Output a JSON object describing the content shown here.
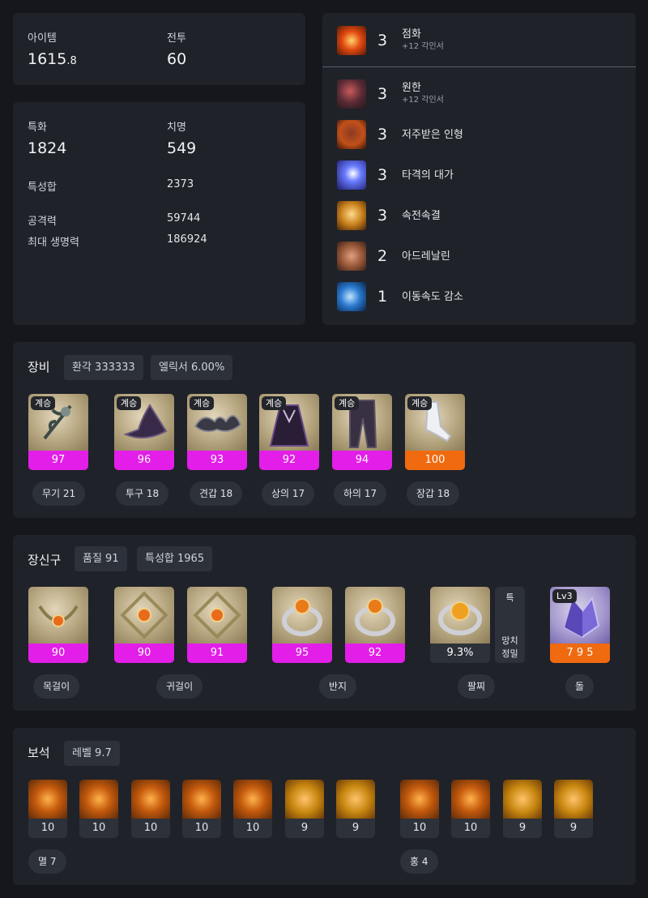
{
  "summary": {
    "item_label": "아이템",
    "item_value": "1615",
    "item_decimal": ".8",
    "combat_label": "전투",
    "combat_value": "60"
  },
  "stats": {
    "spec_label": "특화",
    "spec_value": "1824",
    "crit_label": "치명",
    "crit_value": "549",
    "total_label": "특성합",
    "total_value": "2373",
    "atk_label": "공격력",
    "atk_value": "59744",
    "hp_label": "최대 생명력",
    "hp_value": "186924"
  },
  "engravings": [
    {
      "level": "3",
      "name": "점화",
      "sub": "+12 각인서",
      "icon": "ignite-icon",
      "color": "#d94a12"
    },
    {
      "level": "3",
      "name": "원한",
      "sub": "+12 각인서",
      "icon": "grudge-icon",
      "color": "#7a2a3a"
    },
    {
      "level": "3",
      "name": "저주받은 인형",
      "sub": "",
      "icon": "cursed-doll-icon",
      "color": "#b23a14"
    },
    {
      "level": "3",
      "name": "타격의 대가",
      "sub": "",
      "icon": "hit-master-icon",
      "color": "#4a5fe0"
    },
    {
      "level": "3",
      "name": "속전속결",
      "sub": "",
      "icon": "spirit-absorption-icon",
      "color": "#c8801c"
    },
    {
      "level": "2",
      "name": "아드레날린",
      "sub": "",
      "icon": "adrenaline-icon",
      "color": "#9a5a3a"
    },
    {
      "level": "1",
      "name": "이동속도 감소",
      "sub": "",
      "icon": "speed-down-icon",
      "color": "#2a7ad0"
    }
  ],
  "equipment": {
    "title": "장비",
    "pill1": "환각 333333",
    "pill2": "엘릭서 6.00%",
    "items": [
      {
        "badge": "계승",
        "quality": "97",
        "label": "무기 21",
        "icon": "weapon-icon"
      },
      {
        "badge": "계승",
        "quality": "96",
        "label": "투구 18",
        "icon": "helmet-icon"
      },
      {
        "badge": "계승",
        "quality": "93",
        "label": "견갑 18",
        "icon": "shoulder-icon"
      },
      {
        "badge": "계승",
        "quality": "92",
        "label": "상의 17",
        "icon": "chest-icon"
      },
      {
        "badge": "계승",
        "quality": "94",
        "label": "하의 17",
        "icon": "pants-icon"
      },
      {
        "badge": "계승",
        "quality": "100",
        "label": "장갑 18",
        "icon": "gloves-icon"
      }
    ]
  },
  "accessories": {
    "title": "장신구",
    "pill1": "품질 91",
    "pill2": "특성합 1965",
    "items": [
      {
        "quality": "90",
        "icon": "necklace-icon"
      },
      {
        "quality": "90",
        "icon": "earring-icon"
      },
      {
        "quality": "91",
        "icon": "earring-icon"
      },
      {
        "quality": "95",
        "icon": "ring-icon"
      },
      {
        "quality": "92",
        "icon": "ring-icon"
      },
      {
        "quality": "9.3%",
        "icon": "bracelet-icon"
      }
    ],
    "bracelet_tag_top": "특",
    "bracelet_tag_1": "망치",
    "bracelet_tag_2": "정밀",
    "stone_badge": "Lv3",
    "stone_value": "7 9 5",
    "labels": [
      "목걸이",
      "귀걸이",
      "반지",
      "팔찌",
      "돌"
    ]
  },
  "gems": {
    "title": "보석",
    "pill1": "레벨 9.7",
    "left": [
      "10",
      "10",
      "10",
      "10",
      "10",
      "9",
      "9"
    ],
    "right": [
      "10",
      "10",
      "9",
      "9"
    ],
    "left_label": "멸 7",
    "right_label": "홍 4"
  }
}
